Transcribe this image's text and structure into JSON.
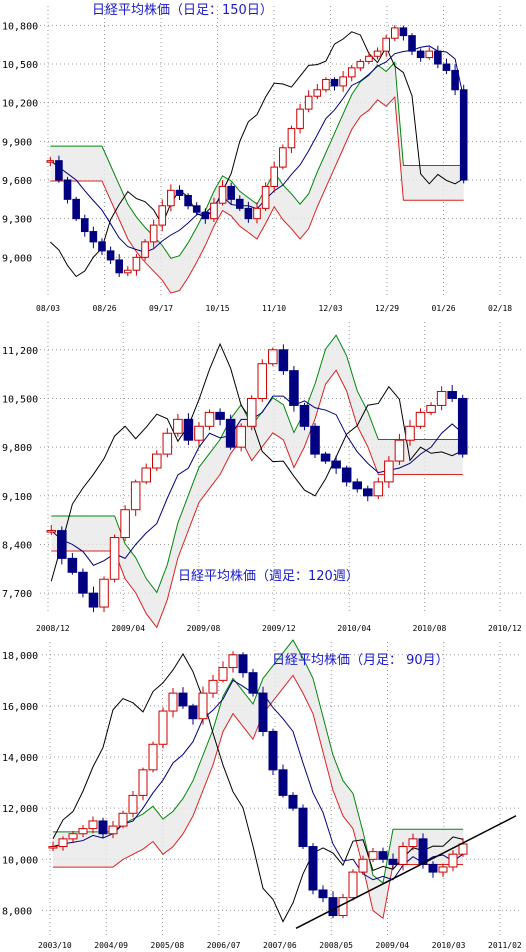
{
  "chart_data": [
    {
      "type": "candlestick",
      "title": "日経平均株価（日足：150日）",
      "ylim": [
        8700,
        10950
      ],
      "yticks": [
        "9,000",
        "9,300",
        "9,600",
        "9,900",
        "10,200",
        "10,500",
        "10,800"
      ],
      "ytick_values": [
        9000,
        9300,
        9600,
        9900,
        10200,
        10500,
        10800
      ],
      "xticks": [
        "08/03",
        "08/26",
        "09/17",
        "10/15",
        "11/10",
        "12/03",
        "12/29",
        "01/26",
        "02/18"
      ],
      "series": [
        {
          "name": "",
          "values": [
            9750,
            9600,
            9450,
            9300,
            9200,
            9120,
            9050,
            8980,
            8880,
            8900,
            9000,
            9120,
            9250,
            9400,
            9520,
            9480,
            9400,
            9350,
            9300,
            9420,
            9550,
            9450,
            9380,
            9300,
            9380,
            9550,
            9700,
            9850,
            10000,
            10150,
            10250,
            10300,
            10380,
            10330,
            10400,
            10470,
            10520,
            10560,
            10600,
            10700,
            10780,
            10720,
            10600,
            10550,
            10600,
            10500,
            10450,
            10300,
            9600
          ]
        }
      ],
      "annotations": []
    },
    {
      "type": "candlestick",
      "title": "日経平均株価（週足：120週）",
      "ylim": [
        7400,
        11600
      ],
      "yticks": [
        "7,700",
        "8,400",
        "9,100",
        "9,800",
        "10,500",
        "11,200"
      ],
      "ytick_values": [
        7700,
        8400,
        9100,
        9800,
        10500,
        11200
      ],
      "xticks": [
        "2008/12",
        "2009/04",
        "2009/08",
        "2009/12",
        "2010/04",
        "2010/08",
        "2010/12"
      ],
      "series": [
        {
          "name": "",
          "values": [
            8600,
            8200,
            8000,
            7700,
            7500,
            7900,
            8500,
            8900,
            9300,
            9500,
            9700,
            10000,
            10200,
            9900,
            10100,
            10300,
            10200,
            9800,
            10100,
            10500,
            11000,
            11200,
            10900,
            10400,
            10100,
            9700,
            9600,
            9500,
            9300,
            9200,
            9100,
            9300,
            9600,
            9900,
            10100,
            10300,
            10400,
            10600,
            10500,
            9700
          ]
        }
      ]
    },
    {
      "type": "candlestick",
      "title": "日経平均株価（月足： 90月）",
      "ylim": [
        7000,
        18500
      ],
      "yticks": [
        "8,000",
        "10,000",
        "12,000",
        "14,000",
        "16,000",
        "18,000"
      ],
      "ytick_values": [
        8000,
        10000,
        12000,
        14000,
        16000,
        18000
      ],
      "xticks": [
        "2003/10",
        "2004/09",
        "2005/08",
        "2006/07",
        "2007/06",
        "2008/05",
        "2009/04",
        "2010/03",
        "2011/02"
      ],
      "series": [
        {
          "name": "",
          "values": [
            10500,
            10800,
            11000,
            11200,
            11500,
            11000,
            11300,
            11800,
            12500,
            13500,
            14500,
            15800,
            16500,
            16000,
            15500,
            16500,
            17000,
            17500,
            18000,
            17300,
            16500,
            15000,
            13500,
            12500,
            12000,
            10500,
            8800,
            8500,
            7800,
            8500,
            9500,
            10000,
            10300,
            10000,
            9800,
            10500,
            10800,
            9800,
            9500,
            9700,
            10200,
            10600
          ]
        }
      ]
    }
  ]
}
